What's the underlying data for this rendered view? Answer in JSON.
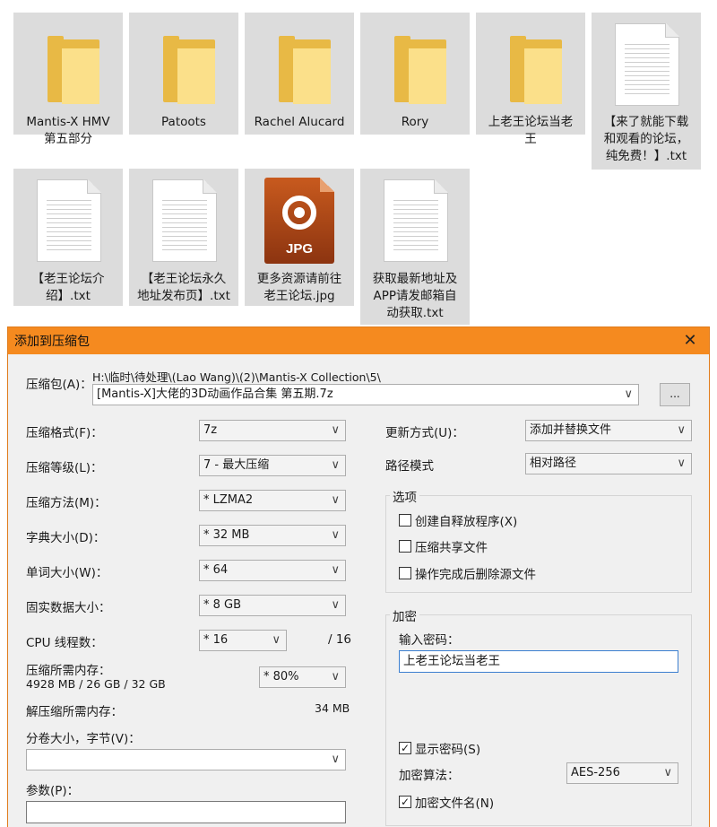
{
  "files": [
    {
      "type": "folder",
      "label": "Mantis-X HMV\n第五部分"
    },
    {
      "type": "folder",
      "label": "Patoots"
    },
    {
      "type": "folder",
      "label": "Rachel Alucard"
    },
    {
      "type": "folder",
      "label": "Rory"
    },
    {
      "type": "folder",
      "label": "上老王论坛当老\n王"
    },
    {
      "type": "txt",
      "label": "【来了就能下载\n和观看的论坛，\n纯免费！】.txt"
    },
    {
      "type": "txt",
      "label": "【老王论坛介\n绍】.txt"
    },
    {
      "type": "txt",
      "label": "【老王论坛永久\n地址发布页】.txt"
    },
    {
      "type": "jpg",
      "label": "更多资源请前往\n老王论坛.jpg",
      "badge": "JPG"
    },
    {
      "type": "txt",
      "label": "获取最新地址及\nAPP请发邮箱自\n动获取.txt"
    }
  ],
  "dialog": {
    "title": "添加到压缩包",
    "close_glyph": "✕",
    "archive_label": "压缩包(A)：",
    "archive_path": "H:\\临时\\待处理\\(Lao Wang)\\(2)\\Mantis-X Collection\\5\\",
    "archive_name": "[Mantis-X]大佬的3D动画作品合集 第五期.7z",
    "browse_label": "...",
    "format_label": "压缩格式(F)：",
    "format_value": "7z",
    "level_label": "压缩等级(L)：",
    "level_value": "7 - 最大压缩",
    "method_label": "压缩方法(M)：",
    "method_value": "* LZMA2",
    "dict_label": "字典大小(D)：",
    "dict_value": "* 32 MB",
    "word_label": "单词大小(W)：",
    "word_value": "* 64",
    "solid_label": "固实数据大小：",
    "solid_value": "* 8 GB",
    "threads_label": "CPU 线程数：",
    "threads_value": "* 16",
    "threads_total": "/ 16",
    "mem_label": "压缩所需内存：",
    "mem_value": "4928 MB / 26 GB / 32 GB",
    "mem_percent": "* 80%",
    "decomp_label": "解压缩所需内存：",
    "decomp_value": "34 MB",
    "volume_label": "分卷大小，字节(V)：",
    "volume_value": "",
    "params_label": "参数(P)：",
    "params_value": "",
    "update_label": "更新方式(U)：",
    "update_value": "添加并替换文件",
    "path_label": "路径模式",
    "path_value": "相对路径",
    "options_legend": "选项",
    "opt_sfx": "创建自释放程序(X)",
    "opt_shared": "压缩共享文件",
    "opt_delete": "操作完成后删除源文件",
    "enc_legend": "加密",
    "pwd_label": "输入密码：",
    "pwd_value": "上老王论坛当老王",
    "show_pwd": "显示密码(S)",
    "enc_method_label": "加密算法：",
    "enc_method_value": "AES-256",
    "enc_names": "加密文件名(N)",
    "check_glyph": "✓"
  }
}
